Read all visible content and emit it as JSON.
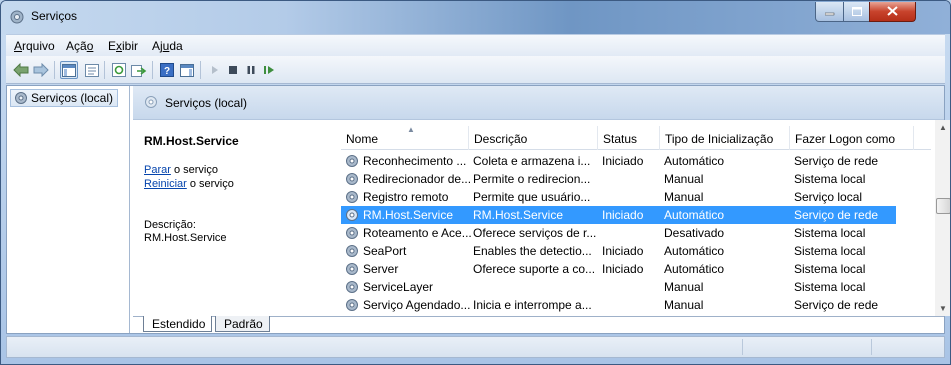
{
  "window": {
    "title": "Serviços"
  },
  "menu": [
    {
      "pre": "",
      "u": "A",
      "post": "rquivo"
    },
    {
      "pre": "Açã",
      "u": "o",
      "post": ""
    },
    {
      "pre": "E",
      "u": "x",
      "post": "ibir"
    },
    {
      "pre": "Aj",
      "u": "u",
      "post": "da"
    }
  ],
  "toolbar": {
    "icons": [
      "back-icon",
      "forward-icon",
      "show-hide-console-tree-icon",
      "properties-icon",
      "refresh-icon",
      "export-list-icon",
      "help-icon",
      "show-hide-action-pane-icon",
      "start-service-icon",
      "stop-service-icon",
      "pause-service-icon",
      "restart-service-icon"
    ]
  },
  "tree": {
    "item_label": "Serviços (local)"
  },
  "header": {
    "title": "Serviços (local)"
  },
  "detail": {
    "service_name": "RM.Host.Service",
    "stop_link": "Parar",
    "stop_suffix": " o serviço",
    "restart_link": "Reiniciar",
    "restart_suffix": " o serviço",
    "description_label": "Descrição:",
    "description_value": "RM.Host.Service"
  },
  "columns": [
    "Nome",
    "Descrição",
    "Status",
    "Tipo de Inicialização",
    "Fazer Logon como"
  ],
  "rows": [
    {
      "name": "Reconhecimento ...",
      "description": "Coleta e armazena i...",
      "status": "Iniciado",
      "startup": "Automático",
      "logon": "Serviço de rede",
      "selected": false
    },
    {
      "name": "Redirecionador de...",
      "description": "Permite o redirecion...",
      "status": "",
      "startup": "Manual",
      "logon": "Sistema local",
      "selected": false
    },
    {
      "name": "Registro remoto",
      "description": "Permite que usuário...",
      "status": "",
      "startup": "Manual",
      "logon": "Serviço local",
      "selected": false
    },
    {
      "name": "RM.Host.Service",
      "description": "RM.Host.Service",
      "status": "Iniciado",
      "startup": "Automático",
      "logon": "Serviço de rede",
      "selected": true
    },
    {
      "name": "Roteamento e Ace...",
      "description": "Oferece serviços de r...",
      "status": "",
      "startup": "Desativado",
      "logon": "Sistema local",
      "selected": false
    },
    {
      "name": "SeaPort",
      "description": "Enables the detectio...",
      "status": "Iniciado",
      "startup": "Automático",
      "logon": "Sistema local",
      "selected": false
    },
    {
      "name": "Server",
      "description": "Oferece suporte a co...",
      "status": "Iniciado",
      "startup": "Automático",
      "logon": "Sistema local",
      "selected": false
    },
    {
      "name": "ServiceLayer",
      "description": "",
      "status": "",
      "startup": "Manual",
      "logon": "Sistema local",
      "selected": false
    },
    {
      "name": "Serviço Agendado...",
      "description": "Inicia e interrompe a...",
      "status": "",
      "startup": "Manual",
      "logon": "Serviço de rede",
      "selected": false
    }
  ],
  "tabs": [
    "Estendido",
    "Padrão"
  ],
  "colors": {
    "selection": "#3399ff",
    "link": "#0645ad"
  }
}
